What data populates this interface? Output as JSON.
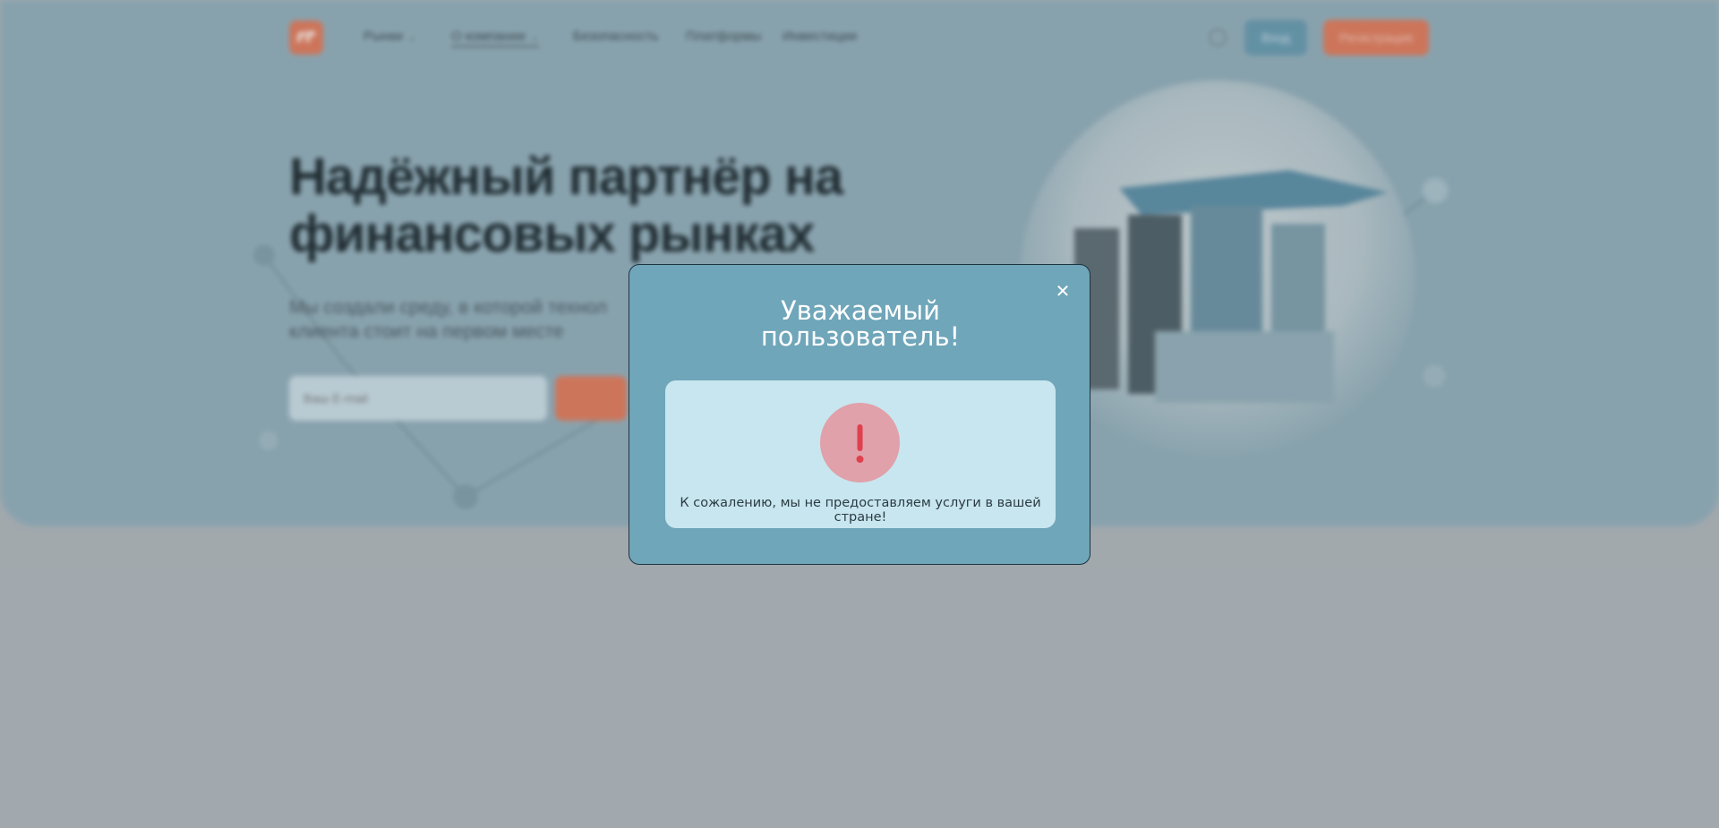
{
  "nav": {
    "items": [
      {
        "label": "Рынки",
        "has_chevron": true
      },
      {
        "label": "О компании",
        "has_chevron": true
      },
      {
        "label": "Безопасность",
        "has_chevron": false
      },
      {
        "label": "Платформы",
        "has_chevron": false
      },
      {
        "label": "Инвестиции",
        "has_chevron": false
      }
    ],
    "login_label": "Вход",
    "register_label": "Регистрация",
    "globe_icon": "globe-icon"
  },
  "hero": {
    "title_line1": "Надёжный партнёр на",
    "title_line2": "финансовых рынках",
    "subtitle_line1": "Мы создали среду, в которой технол",
    "subtitle_line2": "клиента стоит на первом месте",
    "email_placeholder": "Ваш E-mail"
  },
  "modal": {
    "title_line1": "Уважаемый",
    "title_line2": "пользователь!",
    "close_icon": "close-icon",
    "alert_icon": "exclamation-icon",
    "message": "К сожалению, мы не предоставляем услуги в вашей стране!"
  },
  "colors": {
    "modal_bg": "#6fa6b9",
    "alert_box_bg": "#c8e6ef",
    "alert_circle_bg": "#e0a1aa",
    "alert_mark": "#e0404e",
    "accent_orange": "#d9785a",
    "accent_blue": "#6796aa"
  }
}
